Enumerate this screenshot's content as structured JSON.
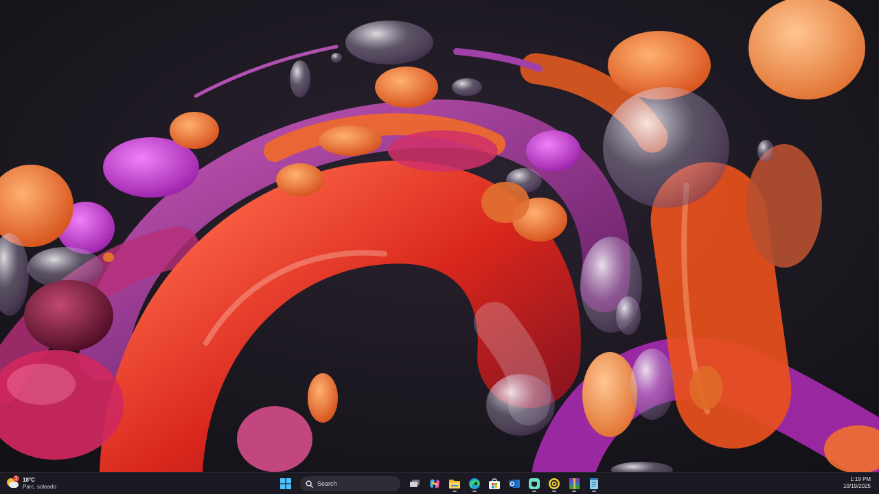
{
  "taskbar": {
    "weather": {
      "temperature": "18°C",
      "condition": "Parc. soleado",
      "badge": "1",
      "icon": "partly-sunny-icon"
    },
    "search": {
      "placeholder": "Search",
      "icon": "search-icon"
    },
    "apps": [
      {
        "name": "Start",
        "icon": "windows-logo-icon"
      },
      {
        "name": "Task View",
        "icon": "task-view-icon"
      },
      {
        "name": "Copilot",
        "icon": "copilot-icon"
      },
      {
        "name": "File Explorer",
        "icon": "folder-icon",
        "running": true
      },
      {
        "name": "Microsoft Edge",
        "icon": "edge-icon",
        "running": true
      },
      {
        "name": "Microsoft Store",
        "icon": "store-icon"
      },
      {
        "name": "Outlook",
        "icon": "outlook-icon"
      },
      {
        "name": "Remote Desktop",
        "icon": "remote-desktop-icon",
        "running": true
      },
      {
        "name": "Copilot App",
        "icon": "copilot-app-icon",
        "running": true
      },
      {
        "name": "WinRAR",
        "icon": "winrar-icon",
        "running": true
      },
      {
        "name": "Notepad",
        "icon": "notepad-icon",
        "running": true
      }
    ],
    "clock": {
      "time": "1:19 PM",
      "date": "10/19/2025"
    }
  },
  "colors": {
    "taskbar_bg": "#1b1a22",
    "desktop_bg": "#141018",
    "wallpaper_orange": "#f07a2a",
    "wallpaper_red": "#e8321f",
    "wallpaper_magenta": "#c03ac8"
  }
}
